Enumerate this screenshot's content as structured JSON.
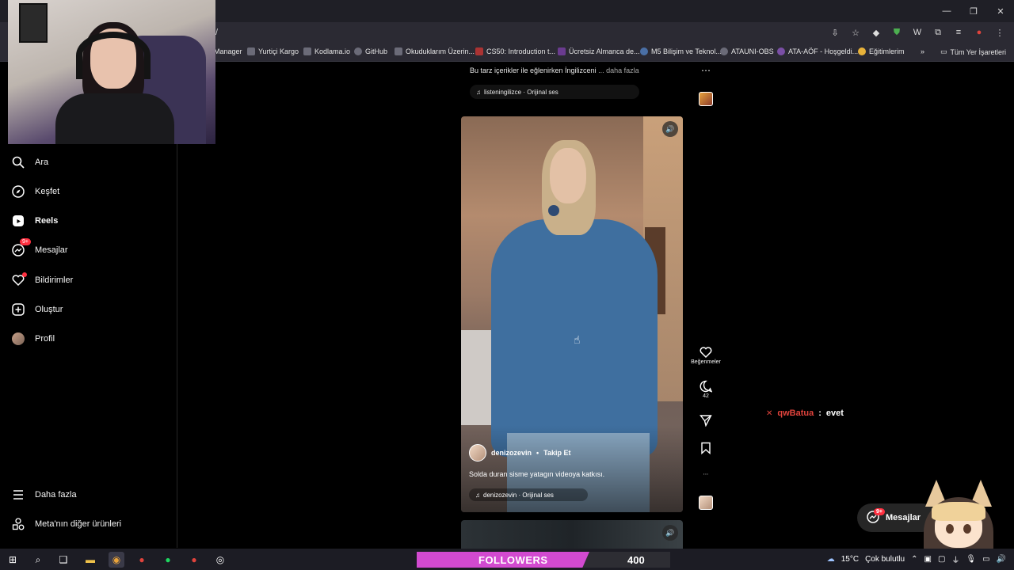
{
  "browser": {
    "url": "/",
    "bookmarks": [
      {
        "label": "Manager",
        "icon": "page-icon"
      },
      {
        "label": "Yurtiçi Kargo",
        "icon": "cargo-icon"
      },
      {
        "label": "Kodlama.io",
        "icon": "code-icon"
      },
      {
        "label": "GitHub",
        "icon": "github-icon"
      },
      {
        "label": "Okuduklarım Üzerin...",
        "icon": "image-icon"
      },
      {
        "label": "CS50: Introduction t...",
        "icon": "cs50-icon"
      },
      {
        "label": "Ücretsiz Almanca de...",
        "icon": "book-icon"
      },
      {
        "label": "M5 Bilişim ve Teknol...",
        "icon": "drop-icon"
      },
      {
        "label": "ATAUNI-OBS",
        "icon": "globe-icon"
      },
      {
        "label": "ATA-AÖF - Hoşgeldi...",
        "icon": "globe-icon"
      },
      {
        "label": "Eğitimlerim",
        "icon": "circle-icon"
      }
    ],
    "bookmarks_overflow": "»",
    "all_bookmarks": "Tüm Yer İşaretleri"
  },
  "sidebar": {
    "items": [
      {
        "label": "Ara",
        "icon": "search-icon"
      },
      {
        "label": "Keşfet",
        "icon": "compass-icon"
      },
      {
        "label": "Reels",
        "icon": "reels-icon"
      },
      {
        "label": "Mesajlar",
        "icon": "messenger-icon",
        "badge": "9+"
      },
      {
        "label": "Bildirimler",
        "icon": "heart-icon"
      },
      {
        "label": "Oluştur",
        "icon": "plus-square-icon"
      },
      {
        "label": "Profil",
        "icon": "avatar"
      }
    ],
    "more": "Daha fazla",
    "meta_products": "Meta'nın diğer ürünleri"
  },
  "previous_post": {
    "caption": "Bu tarz içerikler ile eğlenirken İngilizceni",
    "more": "... daha fazla",
    "audio": "listeningilizce · Orijinal ses"
  },
  "reel": {
    "username": "denizozevin",
    "separator": "•",
    "follow": "Takip Et",
    "caption": "Solda duran sisme yatagın videoya katkısı.",
    "audio": "denizozevin · Orijinal ses",
    "likes_label": "Beğenmeler",
    "comments_count": "42"
  },
  "chat": {
    "user": "qwBatua",
    "separator": ":",
    "message": "evet"
  },
  "messages_pill": {
    "label": "Mesajlar",
    "badge": "9+"
  },
  "followers_goal": {
    "label": "FOLLOWERS",
    "count": "400",
    "progress": 0.68,
    "color": "#d24ad0"
  },
  "taskbar": {
    "weather": "15°C",
    "weather_text": "Çok bulutlu"
  },
  "colors": {
    "accent_red": "#ff3040",
    "chat_red": "#e0433c"
  }
}
